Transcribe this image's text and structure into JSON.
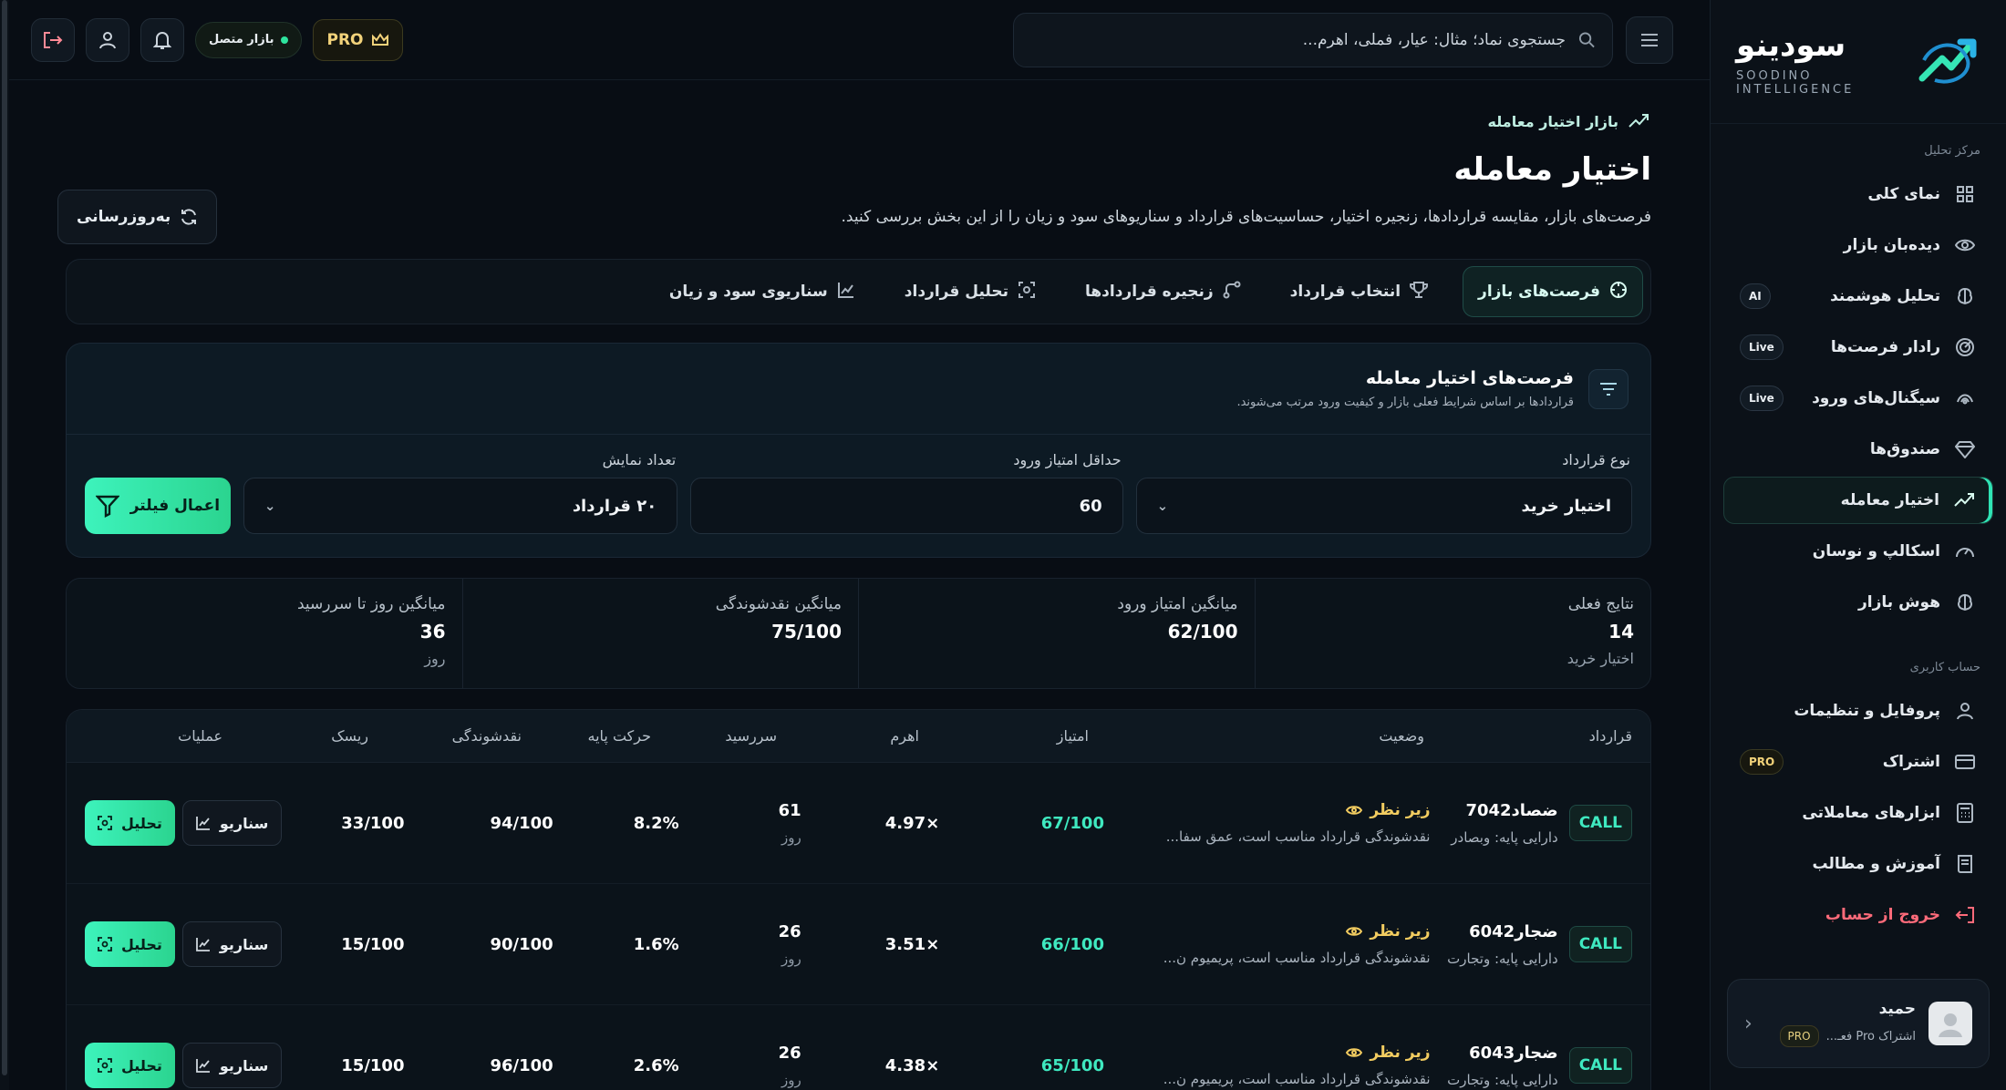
{
  "brand": {
    "name": "سودینو",
    "tagline": "SOODINO INTELLIGENCE"
  },
  "sidebar": {
    "section_analysis": "مرکز تحلیل",
    "items": [
      {
        "label": "نمای کلی",
        "icon": "grid-icon",
        "badge": ""
      },
      {
        "label": "دیده‌بان بازار",
        "icon": "eye-icon",
        "badge": ""
      },
      {
        "label": "تحلیل هوشمند",
        "icon": "brain-icon",
        "badge": "AI"
      },
      {
        "label": "رادار فرصت‌ها",
        "icon": "radar-icon",
        "badge": "Live"
      },
      {
        "label": "سیگنال‌های ورود",
        "icon": "signal-icon",
        "badge": "Live"
      },
      {
        "label": "صندوق‌ها",
        "icon": "diamond-icon",
        "badge": ""
      },
      {
        "label": "اختیار معامله",
        "icon": "options-icon",
        "badge": ""
      },
      {
        "label": "اسکالپ و نوسان",
        "icon": "gauge-icon",
        "badge": ""
      },
      {
        "label": "هوش بازار",
        "icon": "brain-icon",
        "badge": ""
      }
    ],
    "section_account": "حساب کاربری",
    "account_items": [
      {
        "label": "پروفایل و تنظیمات",
        "icon": "user-icon",
        "badge": ""
      },
      {
        "label": "اشتراک",
        "icon": "card-icon",
        "badge": "PRO"
      },
      {
        "label": "ابزارهای معاملاتی",
        "icon": "calculator-icon",
        "badge": ""
      },
      {
        "label": "آموزش و مطالب",
        "icon": "book-icon",
        "badge": ""
      },
      {
        "label": "خروج از حساب",
        "icon": "logout-icon",
        "badge": ""
      }
    ],
    "user": {
      "name": "حمید",
      "subscription": "اشتراک Pro فعـ...",
      "pro_badge": "PRO"
    }
  },
  "topbar": {
    "search_placeholder": "جستجوی نماد؛ مثال: عیار، فملی، اهرم...",
    "pro_label": "PRO",
    "market_status": "بازار متصل"
  },
  "page": {
    "breadcrumb": "بازار اختیار معامله",
    "title": "اختیار معامله",
    "description": "فرصت‌های بازار، مقایسه قراردادها، زنجیره اختیار، حساسیت‌های قرارداد و سناریوهای سود و زیان را از این بخش بررسی کنید.",
    "refresh_label": "به‌روزرسانی"
  },
  "tabs": [
    {
      "label": "فرصت‌های بازار",
      "icon": "crosshair-icon"
    },
    {
      "label": "انتخاب قرارداد",
      "icon": "trophy-icon"
    },
    {
      "label": "زنجیره قراردادها",
      "icon": "chain-icon"
    },
    {
      "label": "تحلیل قرارداد",
      "icon": "scan-icon"
    },
    {
      "label": "سناریوی سود و زیان",
      "icon": "chart-line-icon"
    }
  ],
  "filter": {
    "title": "فرصت‌های اختیار معامله",
    "subtitle": "قراردادها بر اساس شرایط فعلی بازار و کیفیت ورود مرتب می‌شوند.",
    "type_label": "نوع قرارداد",
    "type_value": "اختیار خرید",
    "min_score_label": "حداقل امتیاز ورود",
    "min_score_value": "60",
    "count_label": "تعداد نمایش",
    "count_value": "۲۰ قرارداد",
    "apply_label": "اعمال فیلتر"
  },
  "stats": [
    {
      "label": "نتایج فعلی",
      "value": "14",
      "sub": "اختیار خرید"
    },
    {
      "label": "میانگین امتیاز ورود",
      "value": "62/100",
      "sub": ""
    },
    {
      "label": "میانگین نقدشوندگی",
      "value": "75/100",
      "sub": ""
    },
    {
      "label": "میانگین روز تا سررسید",
      "value": "36",
      "sub": "روز"
    }
  ],
  "table": {
    "headers": {
      "contract": "قرارداد",
      "status": "وضعیت",
      "score": "امتیاز",
      "leverage": "اهرم",
      "expiry": "سررسید",
      "move": "حرکت پایه",
      "liquidity": "نقدشوندگی",
      "risk": "ریسک",
      "ops": "عملیات"
    },
    "scenario_label": "سناریو",
    "analyze_label": "تحلیل",
    "rows": [
      {
        "type": "CALL",
        "name": "ضصاد7042",
        "underlying": "دارایی پایه: وبصادر",
        "status": "زیر نظر",
        "status_desc": "نقدشوندگی قرارداد مناسب است، عمق سفا...",
        "score": "67/100",
        "leverage": "×4.97",
        "expiry": "61",
        "expiry_unit": "روز",
        "move": "8.2%",
        "liquidity": "94/100",
        "risk": "33/100"
      },
      {
        "type": "CALL",
        "name": "ضجار6042",
        "underlying": "دارایی پایه: وتجارت",
        "status": "زیر نظر",
        "status_desc": "نقدشوندگی قرارداد مناسب است، پریمیوم ن...",
        "score": "66/100",
        "leverage": "×3.51",
        "expiry": "26",
        "expiry_unit": "روز",
        "move": "1.6%",
        "liquidity": "90/100",
        "risk": "15/100"
      },
      {
        "type": "CALL",
        "name": "ضجار6043",
        "underlying": "دارایی پایه: وتجارت",
        "status": "زیر نظر",
        "status_desc": "نقدشوندگی قرارداد مناسب است، پریمیوم ن...",
        "score": "65/100",
        "leverage": "×4.38",
        "expiry": "26",
        "expiry_unit": "روز",
        "move": "2.6%",
        "liquidity": "96/100",
        "risk": "15/100"
      }
    ]
  }
}
